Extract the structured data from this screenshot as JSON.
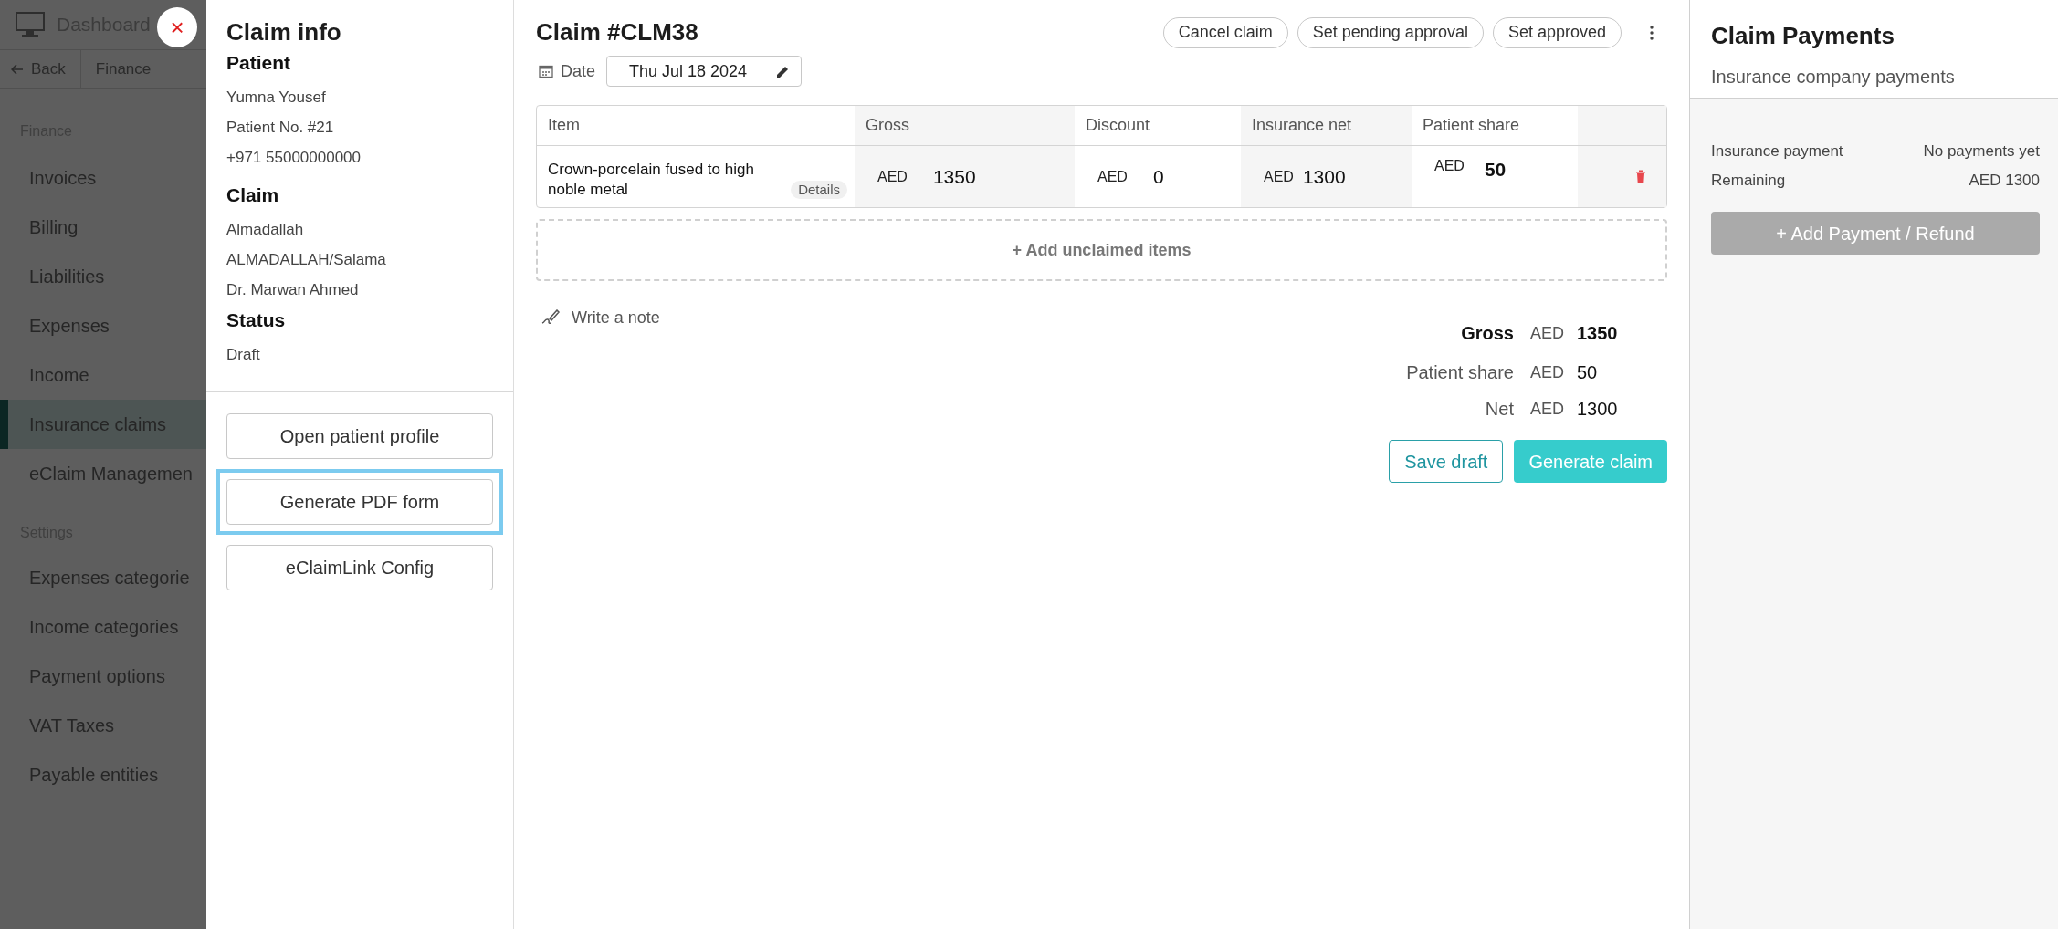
{
  "topbar": {
    "title": "Dashboard"
  },
  "breadcrumb": [
    "Back",
    "Finance"
  ],
  "sidebar": {
    "sections": [
      {
        "title": "Finance",
        "items": [
          {
            "label": "Invoices",
            "selected": false
          },
          {
            "label": "Billing",
            "selected": false
          },
          {
            "label": "Liabilities",
            "selected": false
          },
          {
            "label": "Expenses",
            "selected": false
          },
          {
            "label": "Income",
            "selected": false
          },
          {
            "label": "Insurance claims",
            "selected": true
          },
          {
            "label": "eClaim Managemen",
            "selected": false
          }
        ]
      },
      {
        "title": "Settings",
        "items": [
          {
            "label": "Expenses categorie",
            "selected": false
          },
          {
            "label": "Income categories",
            "selected": false
          },
          {
            "label": "Payment options",
            "selected": false
          },
          {
            "label": "VAT Taxes",
            "selected": false
          },
          {
            "label": "Payable entities",
            "selected": false
          }
        ]
      }
    ]
  },
  "close_button": "×",
  "claim_info": {
    "title": "Claim info",
    "groups": [
      {
        "heading": "Patient",
        "lines": [
          "Yumna Yousef",
          "Patient No. #21",
          "+971 55000000000"
        ]
      },
      {
        "heading": "Claim",
        "lines": [
          "Almadallah",
          "ALMADALLAH/Salama",
          "Dr. Marwan Ahmed"
        ]
      },
      {
        "heading": "Status",
        "lines": [
          "Draft"
        ]
      }
    ],
    "buttons": [
      {
        "label": "Open patient profile",
        "focused": false
      },
      {
        "label": "Generate PDF form",
        "focused": true
      },
      {
        "label": "eClaimLink Config",
        "focused": false
      }
    ]
  },
  "claim": {
    "title": "Claim #CLM38",
    "actions": [
      "Cancel claim",
      "Set pending approval",
      "Set approved"
    ],
    "date_label": "Date",
    "date_value": "Thu Jul 18 2024",
    "table": {
      "columns": [
        "Item",
        "Gross",
        "Discount",
        "Insurance net",
        "Patient share"
      ],
      "rows": [
        {
          "item": "Crown-porcelain fused to high noble metal",
          "details": "Details",
          "gross": {
            "currency": "AED",
            "value": "1350"
          },
          "discount": {
            "currency": "AED",
            "value": "0"
          },
          "insurance_net": {
            "currency": "AED",
            "value": "1300"
          },
          "patient_share": {
            "currency": "AED",
            "value": "50"
          }
        }
      ]
    },
    "add_items": "+ Add unclaimed items",
    "note": "Write a note",
    "totals": [
      {
        "label": "Gross",
        "currency": "AED",
        "value": "1350",
        "bold": true
      },
      {
        "label": "Patient share",
        "currency": "AED",
        "value": "50",
        "bold": false
      },
      {
        "label": "Net",
        "currency": "AED",
        "value": "1300",
        "bold": false
      }
    ],
    "save_button": "Save draft",
    "generate_button": "Generate claim"
  },
  "payments": {
    "title": "Claim Payments",
    "subtitle": "Insurance company payments",
    "rows": [
      {
        "label": "Insurance payment",
        "value": "No payments yet"
      },
      {
        "label": "Remaining",
        "value": "AED 1300"
      }
    ],
    "button": "+ Add Payment / Refund"
  }
}
